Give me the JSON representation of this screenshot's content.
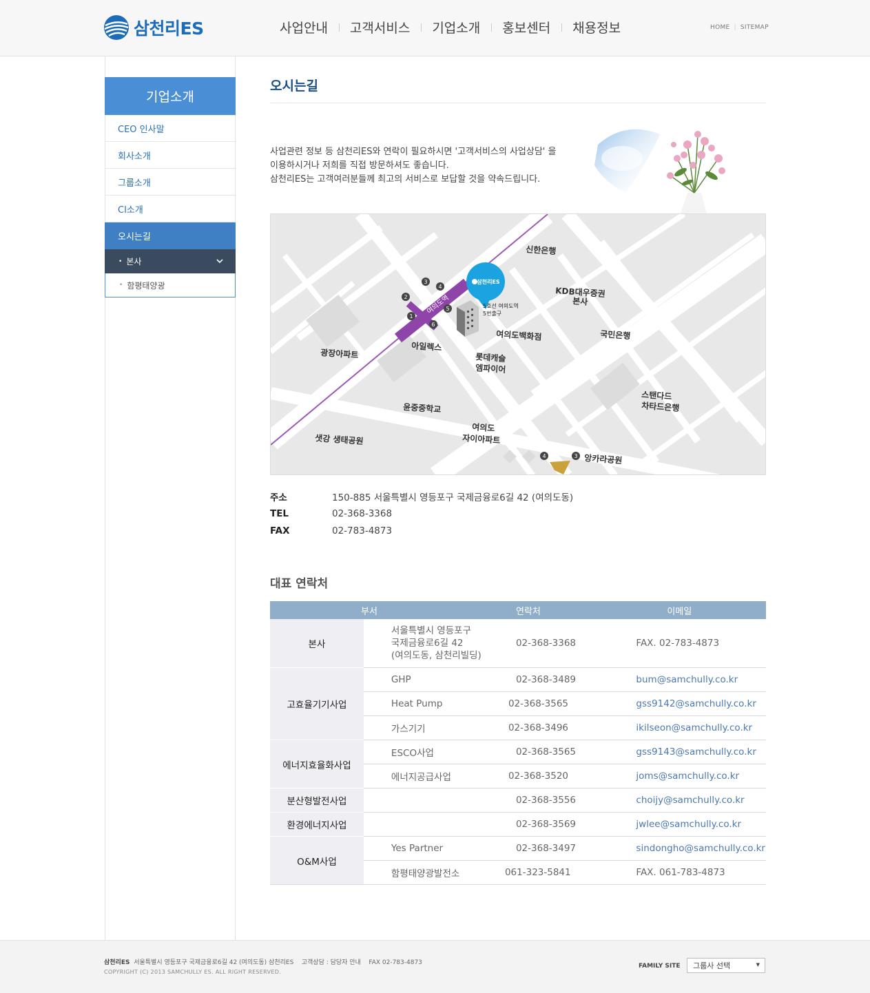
{
  "header": {
    "logo": "삼천리ES",
    "nav": [
      "사업안내",
      "고객서비스",
      "기업소개",
      "홍보센터",
      "채용정보"
    ],
    "util": [
      "HOME",
      "SITEMAP"
    ]
  },
  "sidebar": {
    "title": "기업소개",
    "items": [
      "CEO 인사말",
      "회사소개",
      "그룹소개",
      "CI소개",
      "오시는길"
    ],
    "sub_items": [
      "본사",
      "함평태양광"
    ]
  },
  "main": {
    "title": "오시는길",
    "intro": [
      "사업관련 정보 등 삼천리ES와 연락이 필요하시면 '고객서비스의 사업상담' 을",
      "이용하시거나 저희를 직접 방문하셔도 좋습니다.",
      "삼천리ES는 고객여러분들께 최고의 서비스로 보답할 것을 약속드립니다."
    ],
    "map": {
      "labels": {
        "shinhan": "신한은행",
        "kdb1": "KDB대우증권",
        "kdb2": "본사",
        "kookmin": "국민은행",
        "dept": "여의도백화점",
        "ilex": "아일렉스",
        "lotte1": "롯데캐슬",
        "lotte2": "엠파이어",
        "gwangjang": "광장아파트",
        "yunjung": "윤중중학교",
        "xi1": "여의도",
        "xi2": "자이아파트",
        "saetgang": "샛강 생태공원",
        "sc1": "스탠다드",
        "sc2": "차타드은행",
        "angkara": "앙카라공원",
        "station": "여의도역",
        "exit1": "5호선 여의도역",
        "exit2": "5번출구",
        "pin": "삼천리ES",
        "exits": [
          "1",
          "2",
          "3",
          "4",
          "5",
          "6"
        ],
        "exits_b": [
          "4",
          "3"
        ]
      }
    },
    "address": [
      {
        "k": "주소",
        "v": "150-885  서울특별시 영등포구 국제금융로6길 42 (여의도동)"
      },
      {
        "k": "TEL",
        "v": "02-368-3368"
      },
      {
        "k": "FAX",
        "v": "02-783-4873"
      }
    ],
    "contacts_title": "대표 연락처",
    "contacts_header": [
      "부서",
      "연락처",
      "이메일"
    ],
    "contacts": {
      "hq": {
        "group": "본사",
        "dept1": "서울특별시 영등포구",
        "dept2": "국제금융로6길 42",
        "dept3": "(여의도동, 삼천리빌딩)",
        "tel": "02-368-3368",
        "mail": "FAX. 02-783-4873"
      },
      "r1": {
        "group": "고효율기기사업",
        "dept": "GHP",
        "tel": "02-368-3489",
        "mail": "bum@samchully.co.kr"
      },
      "r2": {
        "dept": "Heat Pump",
        "tel": "02-368-3565",
        "mail": "gss9142@samchully.co.kr"
      },
      "r3": {
        "dept": "가스기기",
        "tel": "02-368-3496",
        "mail": "ikilseon@samchully.co.kr"
      },
      "r4": {
        "group": "에너지효율화사업",
        "dept": "ESCO사업",
        "tel": "02-368-3565",
        "mail": "gss9143@samchully.co.kr"
      },
      "r5": {
        "dept": "에너지공급사업",
        "tel": "02-368-3520",
        "mail": "joms@samchully.co.kr"
      },
      "r6": {
        "group": "분산형발전사업",
        "dept": "",
        "tel": "02-368-3556",
        "mail": "choijy@samchully.co.kr"
      },
      "r7": {
        "group": "환경에너지사업",
        "dept": "",
        "tel": "02-368-3569",
        "mail": "jwlee@samchully.co.kr"
      },
      "r8": {
        "group": "O&M사업",
        "dept": "Yes Partner",
        "tel": "02-368-3497",
        "mail": "sindongho@samchully.co.kr"
      },
      "r9": {
        "dept": "함평태양광발전소",
        "tel": "061-323-5841",
        "mail": "FAX. 061-783-4873"
      }
    }
  },
  "footer": {
    "company": "삼천리ES",
    "address": "서울특별시 영등포구 국제금융로6길 42 (여의도동) 삼천리ES",
    "consult": "고객상담 : 담당자 안내",
    "fax": "FAX 02-783-4873",
    "copyright": "COPYRIGHT (C) 2013 SAMCHULLY ES. ALL RIGHT RESERVED.",
    "family_label": "FAMILY SITE",
    "family_select": "그룹사 선택"
  },
  "colors": {
    "brand": "#1c6cb8",
    "lnb": "#4a8fd6",
    "table_head": "#90aec9",
    "subway": "#8e44a8"
  }
}
